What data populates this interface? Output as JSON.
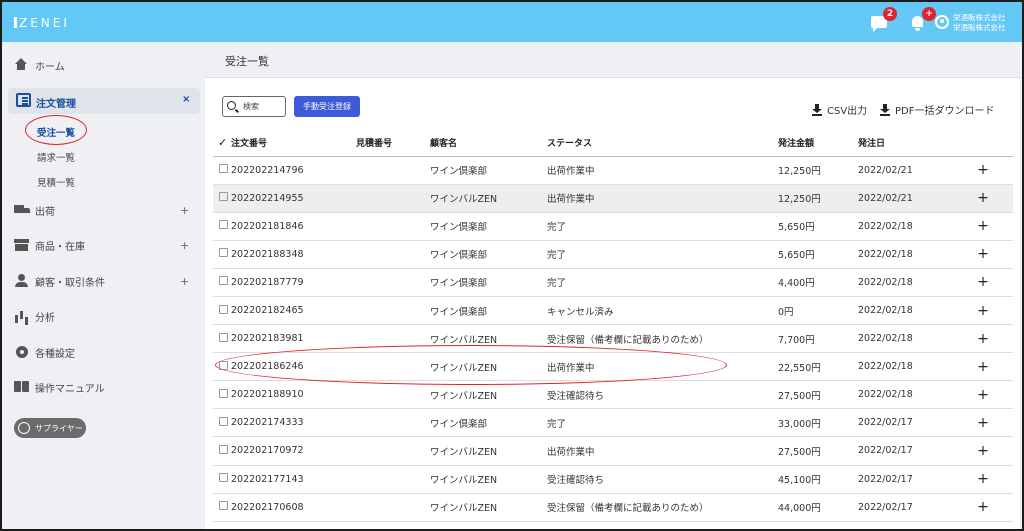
{
  "header": {
    "logo": "ZENEI",
    "chat_badge": "2",
    "bell_badge": "+",
    "company_line1": "栄酒販株式会社",
    "company_line2": "栄酒販株式会社"
  },
  "sidebar": {
    "home": "ホーム",
    "order_mgmt": "注文管理",
    "order_mgmt_close": "×",
    "sub_orders": "受注一覧",
    "sub_invoices": "請求一覧",
    "sub_quotes": "見積一覧",
    "shipping": "出荷",
    "products": "商品・在庫",
    "customers": "顧客・取引条件",
    "analytics": "分析",
    "settings": "各種設定",
    "manual": "操作マニュアル",
    "supplier": "サプライヤー",
    "plus": "+"
  },
  "main": {
    "title": "受注一覧",
    "search_label": "検索",
    "register_button": "手動受注登録",
    "csv_button": "CSV出力",
    "pdf_button": "PDF一括ダウンロード",
    "columns": {
      "check": "✓",
      "order_no": "注文番号",
      "quote_no": "見積番号",
      "customer": "顧客名",
      "status": "ステータス",
      "amount": "発注金額",
      "date": "発注日"
    },
    "rows": [
      {
        "order_no": "202202214796",
        "customer": "ワイン倶楽部",
        "status": "出荷作業中",
        "amount": "12,250円",
        "date": "2022/02/21"
      },
      {
        "order_no": "202202214955",
        "customer": "ワインバルZEN",
        "status": "出荷作業中",
        "amount": "12,250円",
        "date": "2022/02/21"
      },
      {
        "order_no": "202202181846",
        "customer": "ワイン倶楽部",
        "status": "完了",
        "amount": "5,650円",
        "date": "2022/02/18"
      },
      {
        "order_no": "202202188348",
        "customer": "ワイン倶楽部",
        "status": "完了",
        "amount": "5,650円",
        "date": "2022/02/18"
      },
      {
        "order_no": "202202187779",
        "customer": "ワイン倶楽部",
        "status": "完了",
        "amount": "4,400円",
        "date": "2022/02/18"
      },
      {
        "order_no": "202202182465",
        "customer": "ワイン倶楽部",
        "status": "キャンセル済み",
        "amount": "0円",
        "date": "2022/02/18"
      },
      {
        "order_no": "202202183981",
        "customer": "ワインバルZEN",
        "status": "受注保留（備考欄に記載ありのため）",
        "amount": "7,700円",
        "date": "2022/02/18"
      },
      {
        "order_no": "202202186246",
        "customer": "ワインバルZEN",
        "status": "出荷作業中",
        "amount": "22,550円",
        "date": "2022/02/18"
      },
      {
        "order_no": "202202188910",
        "customer": "ワインバルZEN",
        "status": "受注確認待ち",
        "amount": "27,500円",
        "date": "2022/02/18"
      },
      {
        "order_no": "202202174333",
        "customer": "ワイン倶楽部",
        "status": "完了",
        "amount": "33,000円",
        "date": "2022/02/17"
      },
      {
        "order_no": "202202170972",
        "customer": "ワインバルZEN",
        "status": "出荷作業中",
        "amount": "27,500円",
        "date": "2022/02/17"
      },
      {
        "order_no": "202202177143",
        "customer": "ワインバルZEN",
        "status": "受注確認待ち",
        "amount": "45,100円",
        "date": "2022/02/17"
      },
      {
        "order_no": "202202170608",
        "customer": "ワインバルZEN",
        "status": "受注保留（備考欄に記載ありのため）",
        "amount": "44,000円",
        "date": "2022/02/17"
      }
    ],
    "row_expand": "+"
  }
}
